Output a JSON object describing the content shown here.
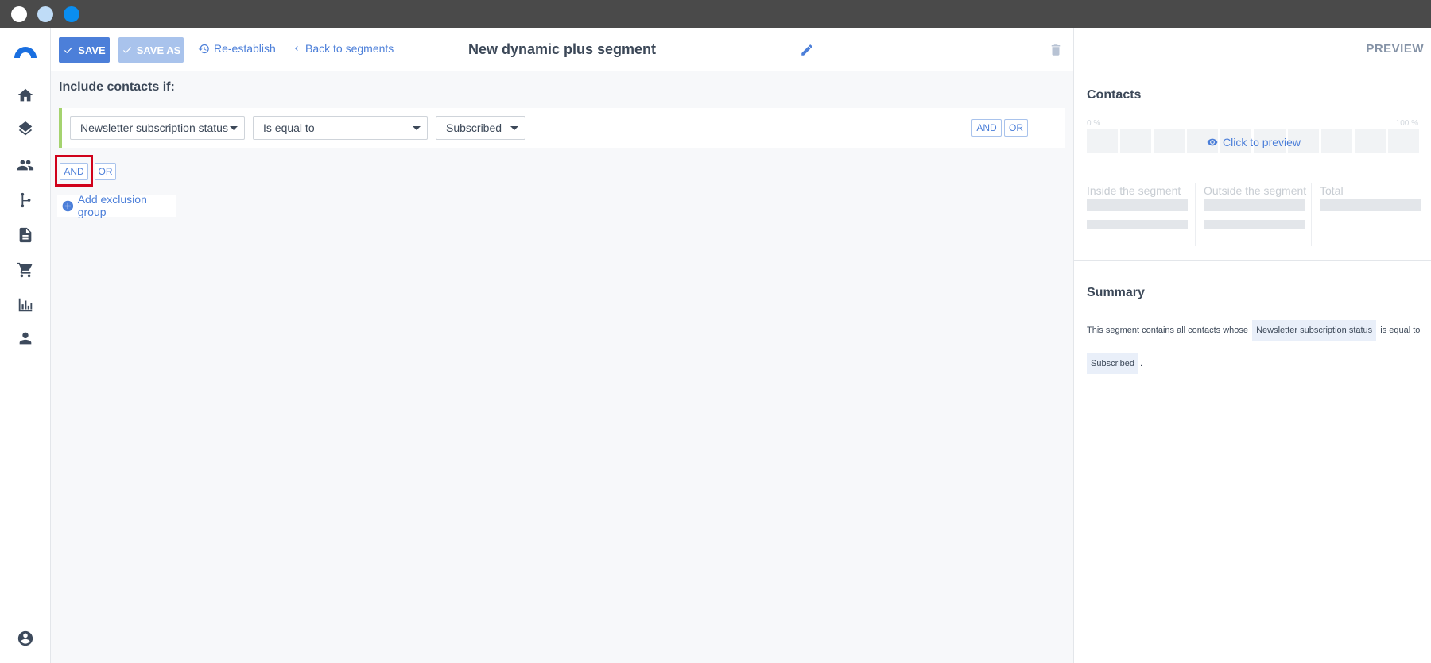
{
  "window": {
    "dots": [
      "#ffffff",
      "#bfdcf7",
      "#0a8ef0"
    ]
  },
  "sidebar": {
    "logo_color": "#1a6fe0",
    "items": [
      {
        "icon": "home-icon"
      },
      {
        "icon": "layers-icon"
      },
      {
        "icon": "people-icon"
      },
      {
        "icon": "workflow-icon"
      },
      {
        "icon": "document-icon"
      },
      {
        "icon": "cart-icon"
      },
      {
        "icon": "bar-chart-icon"
      },
      {
        "icon": "person-icon"
      }
    ],
    "bottom_icon": "account-icon"
  },
  "toolbar": {
    "save_label": "SAVE",
    "save_as_label": "SAVE AS",
    "reestablish_label": "Re-establish",
    "back_label": "Back to segments",
    "title": "New dynamic plus segment"
  },
  "editor": {
    "include_title": "Include contacts if:",
    "rule": {
      "field": "Newsletter subscription status",
      "operator": "Is equal to",
      "value": "Subscribed",
      "and_label": "AND",
      "or_label": "OR"
    },
    "group_and_label": "AND",
    "group_or_label": "OR",
    "add_exclusion_label": "Add exclusion group"
  },
  "preview": {
    "header": "PREVIEW",
    "contacts_title": "Contacts",
    "pct_min": "0 %",
    "pct_max": "100 %",
    "click_to_preview": "Click to preview",
    "inside_label": "Inside the segment",
    "outside_label": "Outside the segment",
    "total_label": "Total",
    "summary_title": "Summary",
    "summary": {
      "prefix": "This segment contains all contacts whose",
      "field": "Newsletter subscription status",
      "middle": "is equal to",
      "value": "Subscribed",
      "suffix": "."
    }
  }
}
